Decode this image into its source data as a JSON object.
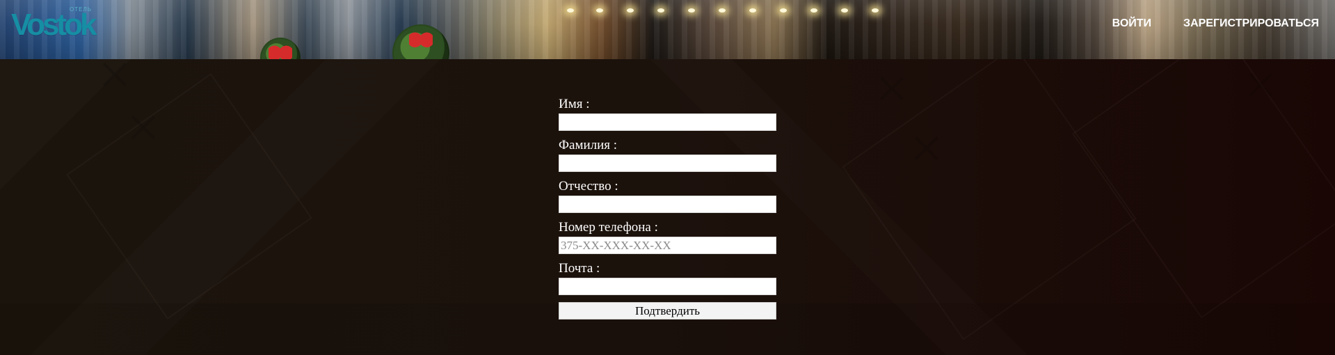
{
  "header": {
    "logo": {
      "small_text": "отель",
      "main_text": "Vostok"
    },
    "nav": {
      "login": "ВОЙТИ",
      "register": "ЗАРЕГИСТРИРОВАТЬСЯ"
    }
  },
  "form": {
    "fields": [
      {
        "label": "Имя :",
        "value": "",
        "placeholder": ""
      },
      {
        "label": "Фамилия :",
        "value": "",
        "placeholder": ""
      },
      {
        "label": "Отчество :",
        "value": "",
        "placeholder": ""
      },
      {
        "label": "Номер телефона :",
        "value": "",
        "placeholder": "375-XX-XXX-XX-XX"
      },
      {
        "label": "Почта :",
        "value": "",
        "placeholder": ""
      }
    ],
    "submit_label": "Подтвердить"
  },
  "theme": {
    "logo_color": "#168ea4",
    "header_text_color": "#ffffff",
    "page_background": "#1b100b",
    "input_background": "#ffffff",
    "button_background": "#f3f3f3"
  }
}
